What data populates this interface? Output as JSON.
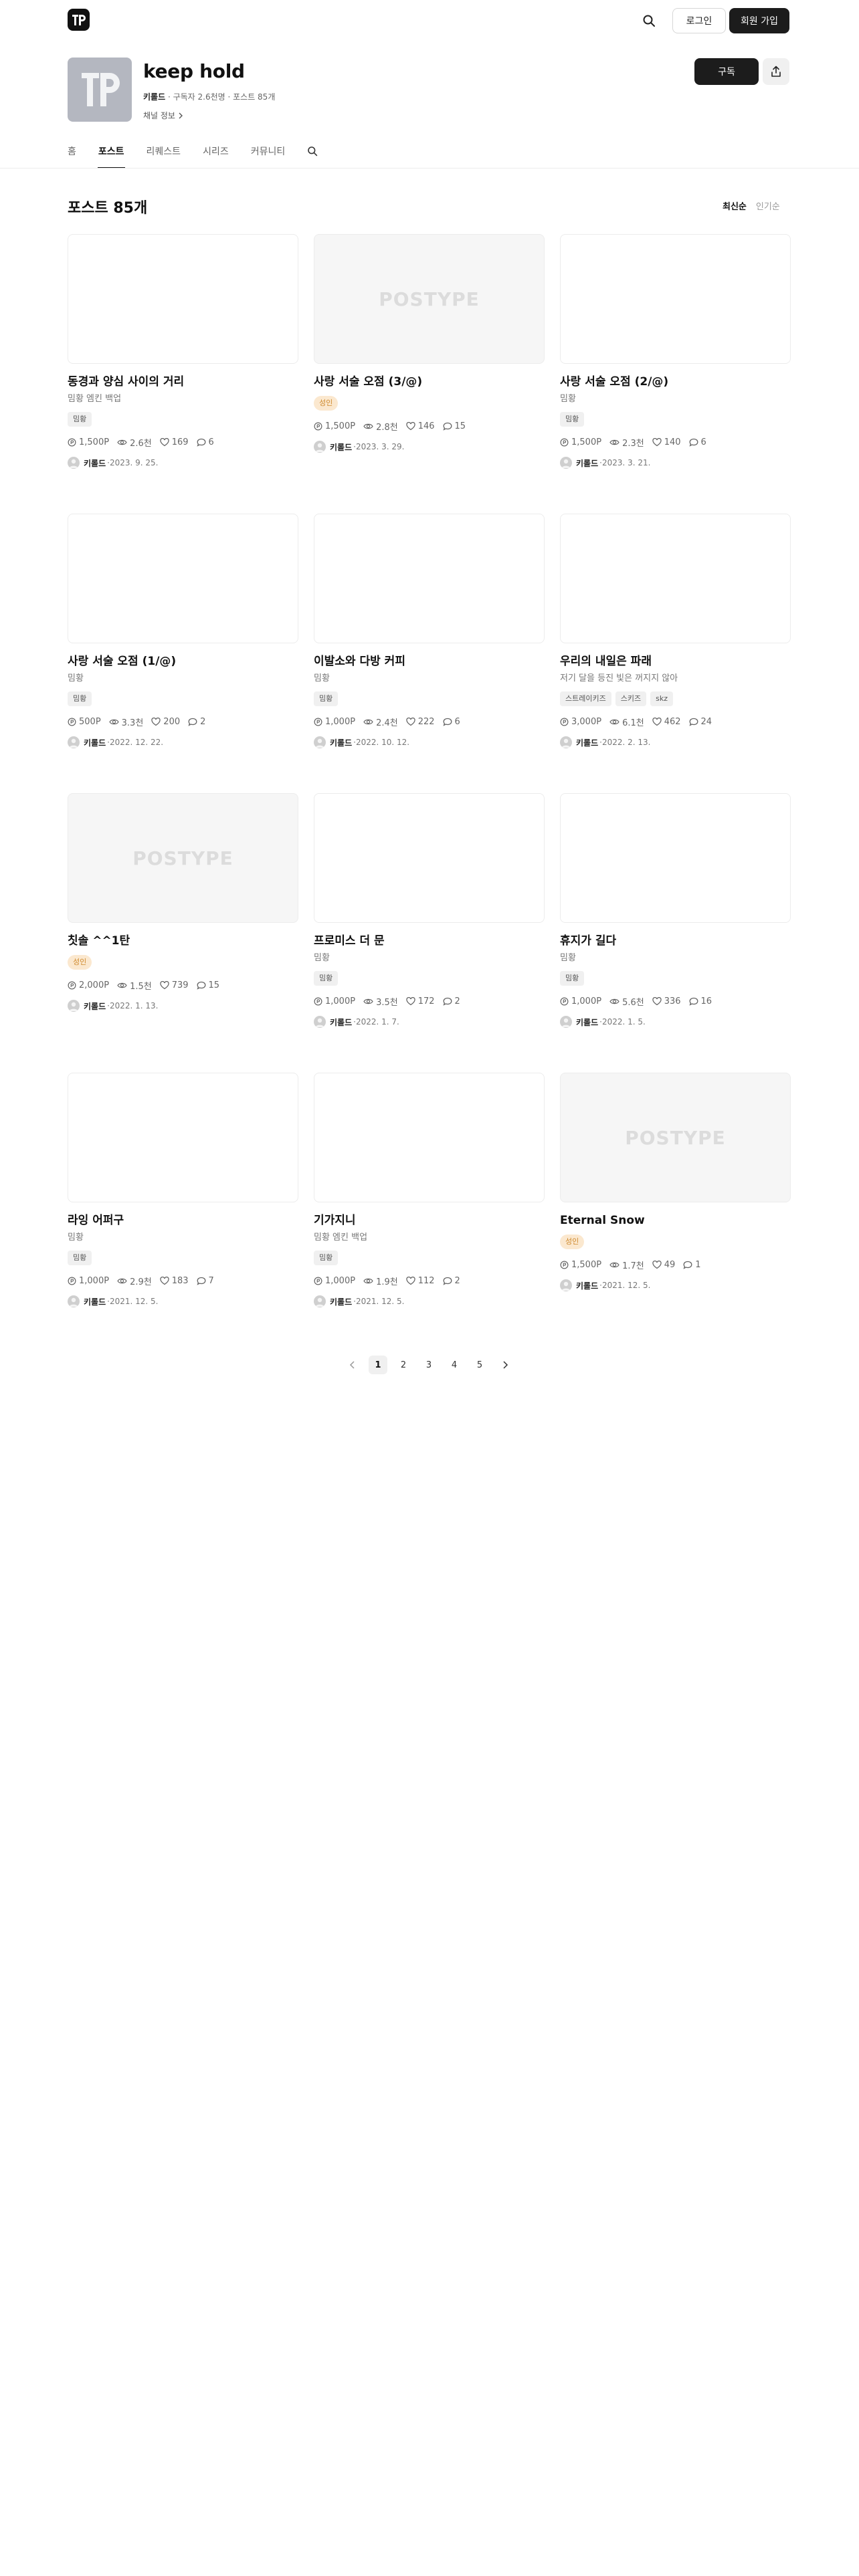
{
  "header": {
    "login_label": "로그인",
    "signup_label": "회원 가입",
    "logo_icon": "postype-logo-icon",
    "search_icon": "search-icon"
  },
  "channel": {
    "name": "keep hold",
    "owner": "키롤드",
    "meta_rest": " · 구독자 2.6천명 · 포스트 85개",
    "info_label": "채널 정보",
    "subscribe_label": "구독",
    "share_icon": "share-icon"
  },
  "tabs": [
    {
      "label": "홈",
      "active": false
    },
    {
      "label": "포스트",
      "active": true
    },
    {
      "label": "리퀘스트",
      "active": false
    },
    {
      "label": "시리즈",
      "active": false
    },
    {
      "label": "커뮤니티",
      "active": false
    }
  ],
  "posts_section": {
    "heading": "포스트 85개",
    "sort_latest": "최신순",
    "sort_popular": "인기순"
  },
  "placeholder_text": "POSTYPE",
  "posts": [
    {
      "title": "동경과 양심 사이의 거리",
      "subtitle": "밈황 엠킨 백업",
      "tags": [
        {
          "label": "밈황",
          "adult": false
        }
      ],
      "price": "1,500P",
      "views": "2.6천",
      "likes": "169",
      "comments": "6",
      "author": "키롤드",
      "date": "·2023. 9. 25.",
      "placeholder": false
    },
    {
      "title": "사랑 서술 오점 (3/@)",
      "subtitle": "",
      "tags": [
        {
          "label": "성인",
          "adult": true
        }
      ],
      "price": "1,500P",
      "views": "2.8천",
      "likes": "146",
      "comments": "15",
      "author": "키롤드",
      "date": "·2023. 3. 29.",
      "placeholder": true
    },
    {
      "title": "사랑 서술 오점 (2/@)",
      "subtitle": "밈황",
      "tags": [
        {
          "label": "밈황",
          "adult": false
        }
      ],
      "price": "1,500P",
      "views": "2.3천",
      "likes": "140",
      "comments": "6",
      "author": "키롤드",
      "date": "·2023. 3. 21.",
      "placeholder": false
    },
    {
      "title": "사랑 서술 오점 (1/@)",
      "subtitle": "밈황",
      "tags": [
        {
          "label": "밈황",
          "adult": false
        }
      ],
      "price": "500P",
      "views": "3.3천",
      "likes": "200",
      "comments": "2",
      "author": "키롤드",
      "date": "·2022. 12. 22.",
      "placeholder": false
    },
    {
      "title": "이발소와 다방 커피",
      "subtitle": "밈황",
      "tags": [
        {
          "label": "밈황",
          "adult": false
        }
      ],
      "price": "1,000P",
      "views": "2.4천",
      "likes": "222",
      "comments": "6",
      "author": "키롤드",
      "date": "·2022. 10. 12.",
      "placeholder": false
    },
    {
      "title": "우리의 내일은 파래",
      "subtitle": "저기 달을 등진 빛은 꺼지지 않아",
      "tags": [
        {
          "label": "스트레이키즈",
          "adult": false
        },
        {
          "label": "스키즈",
          "adult": false
        },
        {
          "label": "skz",
          "adult": false
        }
      ],
      "price": "3,000P",
      "views": "6.1천",
      "likes": "462",
      "comments": "24",
      "author": "키롤드",
      "date": "·2022. 2. 13.",
      "placeholder": false
    },
    {
      "title": "칫솔 ^^1탄",
      "subtitle": "",
      "tags": [
        {
          "label": "성인",
          "adult": true
        }
      ],
      "price": "2,000P",
      "views": "1.5천",
      "likes": "739",
      "comments": "15",
      "author": "키롤드",
      "date": "·2022. 1. 13.",
      "placeholder": true
    },
    {
      "title": "프로미스 더 문",
      "subtitle": "밈황",
      "tags": [
        {
          "label": "밈황",
          "adult": false
        }
      ],
      "price": "1,000P",
      "views": "3.5천",
      "likes": "172",
      "comments": "2",
      "author": "키롤드",
      "date": "·2022. 1. 7.",
      "placeholder": false
    },
    {
      "title": "휴지가 길다",
      "subtitle": "밈황",
      "tags": [
        {
          "label": "밈황",
          "adult": false
        }
      ],
      "price": "1,000P",
      "views": "5.6천",
      "likes": "336",
      "comments": "16",
      "author": "키롤드",
      "date": "·2022. 1. 5.",
      "placeholder": false
    },
    {
      "title": "라잉 어퍼구",
      "subtitle": "밈황",
      "tags": [
        {
          "label": "밈황",
          "adult": false
        }
      ],
      "price": "1,000P",
      "views": "2.9천",
      "likes": "183",
      "comments": "7",
      "author": "키롤드",
      "date": "·2021. 12. 5.",
      "placeholder": false
    },
    {
      "title": "기가지니",
      "subtitle": "밈황 엠킨 백업",
      "tags": [
        {
          "label": "밈황",
          "adult": false
        }
      ],
      "price": "1,000P",
      "views": "1.9천",
      "likes": "112",
      "comments": "2",
      "author": "키롤드",
      "date": "·2021. 12. 5.",
      "placeholder": false
    },
    {
      "title": "Eternal Snow",
      "subtitle": "",
      "tags": [
        {
          "label": "성인",
          "adult": true
        }
      ],
      "price": "1,500P",
      "views": "1.7천",
      "likes": "49",
      "comments": "1",
      "author": "키롤드",
      "date": "·2021. 12. 5.",
      "placeholder": true
    }
  ],
  "pagination": {
    "prev_icon": "chevron-left-icon",
    "next_icon": "chevron-right-icon",
    "pages": [
      "1",
      "2",
      "3",
      "4",
      "5"
    ],
    "current": "1"
  },
  "icons": {
    "price": "coin-icon",
    "views": "eye-icon",
    "likes": "heart-icon",
    "comments": "comment-icon"
  }
}
